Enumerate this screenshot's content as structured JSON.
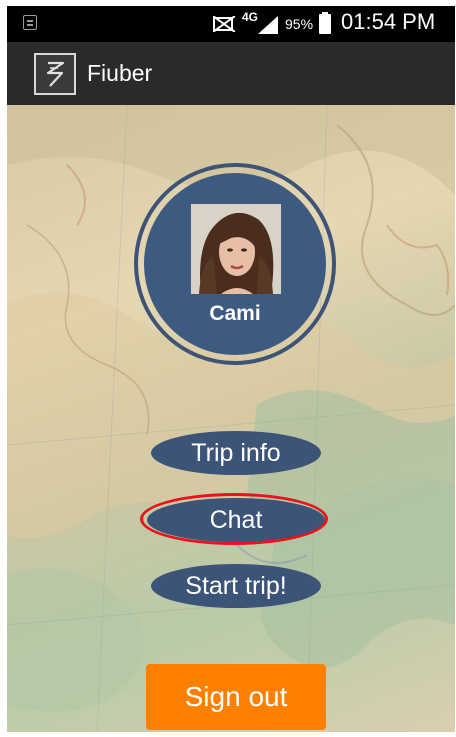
{
  "status_bar": {
    "network": "4G",
    "battery_percent": "95%",
    "time": "01:54 PM"
  },
  "app_bar": {
    "title": "Fiuber",
    "logo_icon": "fiuber-logo-icon"
  },
  "profile": {
    "name": "Cami",
    "avatar_icon": "user-photo"
  },
  "buttons": {
    "trip_info": "Trip info",
    "chat": "Chat",
    "start_trip": "Start trip!",
    "sign_out": "Sign out"
  },
  "colors": {
    "button_blue": "#3b5478",
    "profile_blue": "#3d5a80",
    "sign_out_orange": "#ff7f00",
    "highlight_red": "#e6141c",
    "app_bar": "#2a2a2a"
  }
}
